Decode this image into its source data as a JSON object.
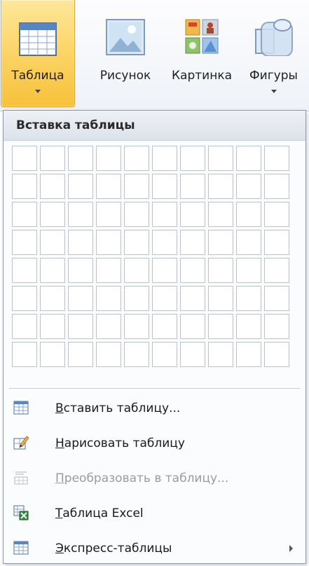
{
  "ribbon": {
    "buttons": [
      {
        "id": "table",
        "label": "Таблица",
        "has_arrow": true,
        "active": true,
        "icon": "table-icon"
      },
      {
        "id": "picture",
        "label": "Рисунок",
        "has_arrow": false,
        "active": false,
        "icon": "picture-icon"
      },
      {
        "id": "clipart",
        "label": "Картинка",
        "has_arrow": false,
        "active": false,
        "icon": "clipart-icon"
      },
      {
        "id": "shapes",
        "label": "Фигуры",
        "has_arrow": true,
        "active": false,
        "icon": "shapes-icon"
      }
    ]
  },
  "panel": {
    "header": "Вставка таблицы",
    "grid": {
      "columns": 10,
      "rows": 8
    },
    "menu": [
      {
        "accel": "В",
        "rest": "ставить таблицу...",
        "icon": "insert-table-icon",
        "enabled": true,
        "submenu": false
      },
      {
        "accel": "Н",
        "rest": "арисовать таблицу",
        "icon": "draw-table-icon",
        "enabled": true,
        "submenu": false
      },
      {
        "accel": "П",
        "rest": "реобразовать в таблицу...",
        "icon": "convert-to-table-icon",
        "enabled": false,
        "submenu": false
      },
      {
        "accel": "Т",
        "rest": "аблица Excel",
        "icon": "excel-table-icon",
        "enabled": true,
        "submenu": false
      },
      {
        "accel": "Э",
        "rest": "кспресс-таблицы",
        "icon": "quick-tables-icon",
        "enabled": true,
        "submenu": true
      }
    ]
  },
  "colors": {
    "active_button": "#fbd261",
    "grid_border": "#b9c2cc",
    "disabled_text": "#9b9b9b"
  }
}
